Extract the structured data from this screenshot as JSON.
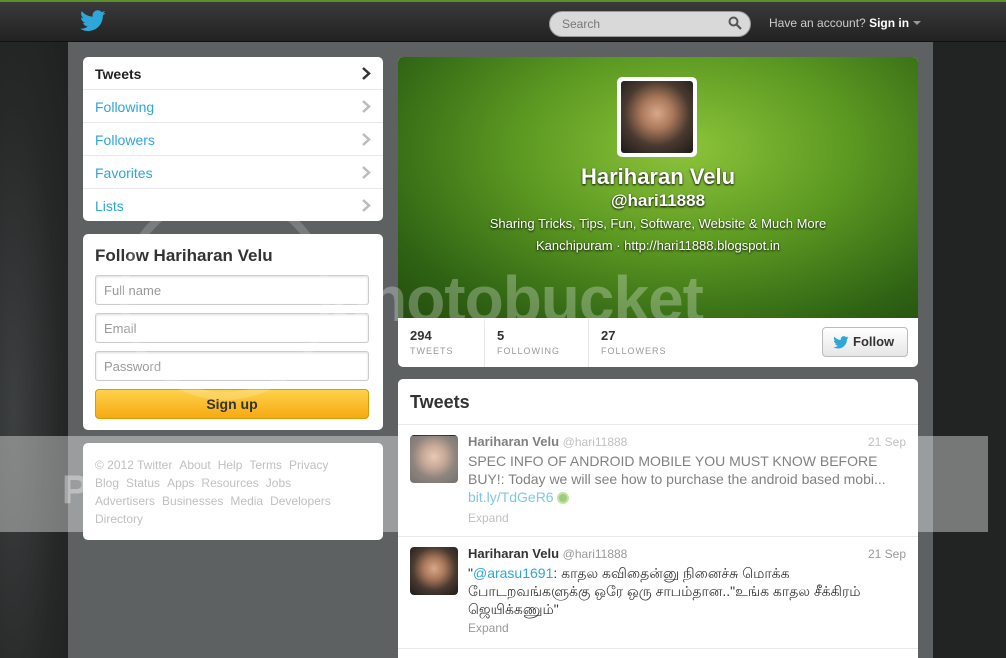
{
  "topbar": {
    "search_placeholder": "Search",
    "account_text": "Have an account?",
    "signin_label": "Sign in"
  },
  "nav": {
    "items": [
      {
        "label": "Tweets"
      },
      {
        "label": "Following"
      },
      {
        "label": "Followers"
      },
      {
        "label": "Favorites"
      },
      {
        "label": "Lists"
      }
    ]
  },
  "follow_box": {
    "title": "Follow Hariharan Velu",
    "fullname_placeholder": "Full name",
    "email_placeholder": "Email",
    "password_placeholder": "Password",
    "signup_label": "Sign up"
  },
  "footer": {
    "links": [
      "© 2012 Twitter",
      "About",
      "Help",
      "Terms",
      "Privacy",
      "Blog",
      "Status",
      "Apps",
      "Resources",
      "Jobs",
      "Advertisers",
      "Businesses",
      "Media",
      "Developers",
      "Directory"
    ]
  },
  "profile": {
    "name": "Hariharan Velu",
    "handle": "@hari11888",
    "bio": "Sharing Tricks, Tips, Fun, Software, Website & Much More",
    "location_line": "Kanchipuram · http://hari11888.blogspot.in",
    "stats": [
      {
        "value": "294",
        "label": "TWEETS"
      },
      {
        "value": "5",
        "label": "FOLLOWING"
      },
      {
        "value": "27",
        "label": "FOLLOWERS"
      }
    ],
    "follow_label": "Follow"
  },
  "tweets": {
    "title": "Tweets",
    "items": [
      {
        "name": "Hariharan Velu",
        "handle": "@hari11888",
        "time": "21 Sep",
        "text": "SPEC INFO OF ANDROID MOBILE YOU MUST KNOW BEFORE BUY!: Today we will see how to purchase the android based mobi...",
        "link": "bit.ly/TdGeR6",
        "expand": "Expand"
      },
      {
        "name": "Hariharan Velu",
        "handle": "@hari11888",
        "time": "21 Sep",
        "mention": "@arasu1691",
        "text_prefix": "\"",
        "text": ": காதல கவிதைன்னு நினைச்சு மொக்க போடறவங்களுக்கு ஒரே ஒரு சாபம்தான..\"உங்க காதல சீக்கிரம் ஜெயிக்கணும்\"",
        "expand": "Expand"
      }
    ]
  },
  "watermark": {
    "text": "photobucket",
    "left": "P",
    "right": "!"
  },
  "colors": {
    "link": "#2fa6d8",
    "signup": "#f7a912",
    "header_green": "#5d9a22"
  }
}
